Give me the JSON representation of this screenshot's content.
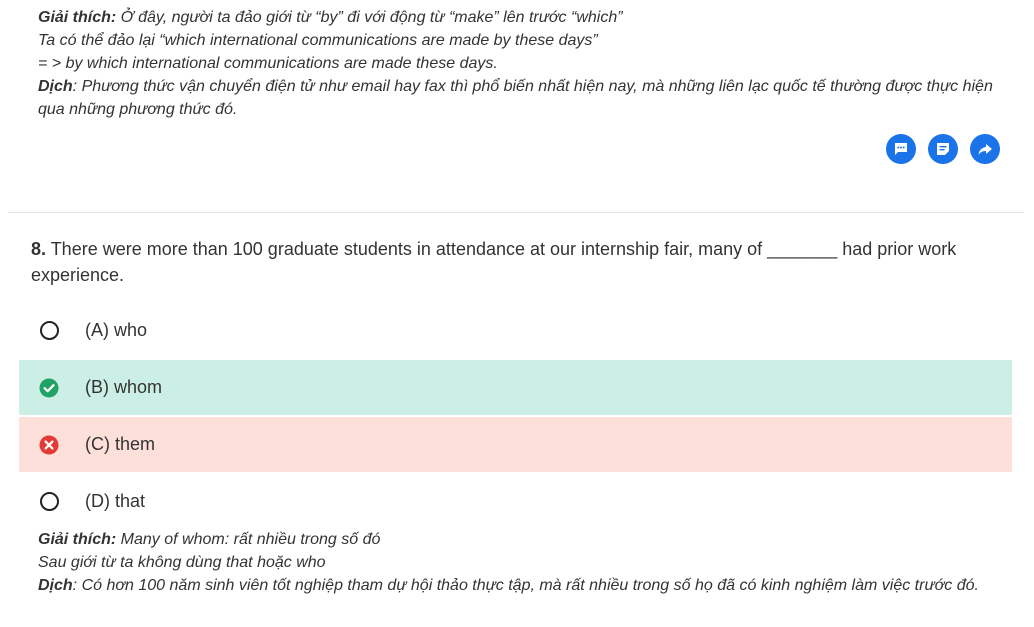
{
  "prev_explanation": {
    "label": "Giải thích:",
    "line1_text": " Ở đây, người ta đảo giới từ “by” đi với động từ “make” lên trước “which”",
    "line2": "Ta có thể đảo lại “which international communications are made by these days”",
    "line3": "= > by which international communications are made these days.",
    "translation_label": "Dịch",
    "translation_text": ": Phương thức vận chuyển điện tử như email hay fax thì phổ biến nhất hiện nay, mà những liên lạc quốc tế thường được thực hiện qua những phương thức đó."
  },
  "actions": {
    "icons": [
      "comment-icon",
      "note-icon",
      "share-icon"
    ],
    "color": "#1a73e8"
  },
  "question": {
    "number": "8.",
    "text": " There were more than 100 graduate students in attendance at our internship fair, many of _______ had prior work experience.",
    "options": [
      {
        "label": "(A) who",
        "state": "none"
      },
      {
        "label": "(B) whom",
        "state": "correct"
      },
      {
        "label": "(C) them",
        "state": "wrong"
      },
      {
        "label": "(D) that",
        "state": "none"
      }
    ]
  },
  "explanation": {
    "label": "Giải thích:",
    "line1_text": " Many of whom: rất nhiều trong số đó",
    "line2": "Sau giới từ ta không dùng that hoặc who",
    "translation_label": "Dịch",
    "translation_text": ": Có hơn 100 năm sinh viên tốt nghiệp tham dự hội thảo thực tập, mà rất nhiều trong số họ đã có kinh nghiệm làm việc trước đó."
  },
  "colors": {
    "correct_bg": "#ccefe5",
    "wrong_bg": "#fde0d9",
    "correct_icon": "#21a366",
    "wrong_icon": "#e53935"
  }
}
